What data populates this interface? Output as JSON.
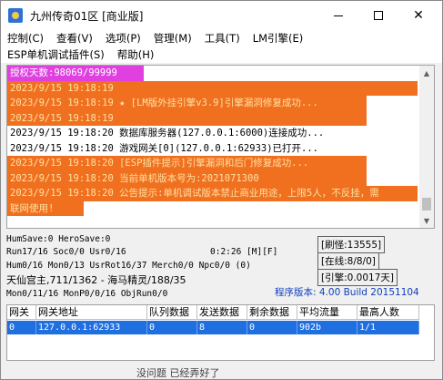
{
  "window": {
    "title": "九州传奇01区 [商业版]"
  },
  "menu": {
    "row1": [
      "控制(C)",
      "查看(V)",
      "选项(P)",
      "管理(M)",
      "工具(T)",
      "LM引擎(E)"
    ],
    "row2": [
      "ESP单机调试插件(S)",
      "帮助(H)"
    ]
  },
  "log": [
    {
      "style": "magenta",
      "text": "授权天数:98069/99999"
    },
    {
      "style": "orange-full",
      "text": "2023/9/15 19:18:19"
    },
    {
      "style": "orange",
      "text": "2023/9/15 19:18:19 ★ [LM版外挂引擎v3.9]引擎漏洞修复成功..."
    },
    {
      "style": "orange",
      "text": "2023/9/15 19:18:19"
    },
    {
      "style": "plain",
      "text": "2023/9/15 19:18:20 数据库服务器(127.0.0.1:6000)连接成功..."
    },
    {
      "style": "plain",
      "text": "2023/9/15 19:18:20 游戏网关[0](127.0.0.1:62933)已打开..."
    },
    {
      "style": "orange",
      "text": "2023/9/15 19:18:20 [ESP插件提示]引擎漏洞和后门修复成功..."
    },
    {
      "style": "orange",
      "text": "2023/9/15 19:18:20 当前单机版本号为:2021071300"
    },
    {
      "style": "orange-full",
      "text": "2023/9/15 19:18:20 公告提示:单机调试版本禁止商业用途，上限5人，不反挂，需"
    },
    {
      "style": "orange-short",
      "text": "联网使用!"
    }
  ],
  "status": {
    "line1": "HumSave:0 HeroSave:0",
    "line2": "Run17/16 Soc0/0 Usr0/16",
    "time": "0:2:26 [M][F]",
    "line3": "Hum0/16 Mon0/13 UsrRot16/37 Merch0/0 Npc0/0 (0)",
    "line4": "天仙宫主,711/1362 - 海马精灵/188/35",
    "line5": "Mon0/11/16 MonP0/0/16 ObjRun0/0",
    "refresh": "[刷怪:13555]",
    "online": "[在线:8/8/0]",
    "engine": "[引擎:0.0017天]",
    "version": "程序版本: 4.00 Build 20151104"
  },
  "table": {
    "headers": [
      "网关",
      "网关地址",
      "队列数据",
      "发送数据",
      "剩余数据",
      "平均流量",
      "最高人数"
    ],
    "rows": [
      [
        "0",
        "127.0.0.1:62933",
        "0",
        "8",
        "0",
        "902b",
        "1/1"
      ]
    ]
  },
  "bottom_text": "没问题 已经弄好了"
}
